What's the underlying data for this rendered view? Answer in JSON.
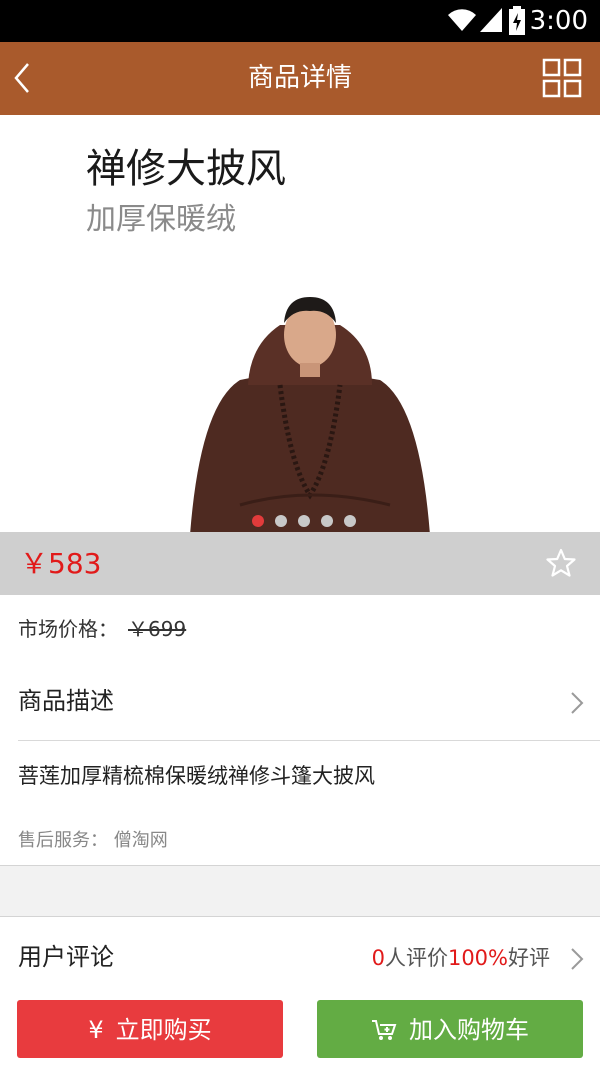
{
  "status_bar": {
    "time": "3:00",
    "icons": [
      "wifi-icon",
      "signal-icon",
      "battery-charging-icon"
    ]
  },
  "header": {
    "title": "商品详情",
    "back_icon": "back-arrow-icon",
    "menu_icon": "grid-menu-icon",
    "bg_color": "#a95a2c"
  },
  "hero": {
    "headline": "禅修大披风",
    "subline": "加厚保暖绒",
    "carousel_total": 5,
    "carousel_active": 1
  },
  "price": {
    "current": "￥583",
    "favorite_icon": "star-outline-icon",
    "color": "#e11a1a"
  },
  "market_price": {
    "label": "市场价格：",
    "value": "￥699"
  },
  "description": {
    "label": "商品描述",
    "text": "菩莲加厚精梳棉保暖绒禅修斗篷大披风"
  },
  "service": {
    "label": "售后服务：",
    "provider": "僧淘网"
  },
  "reviews": {
    "label": "用户评论",
    "count": "0",
    "count_suffix": "人评价",
    "rate": "100%",
    "rate_suffix": "好评"
  },
  "actions": {
    "buy": {
      "icon": "yen-icon",
      "label": "立即购买",
      "color": "#e83b3e"
    },
    "cart": {
      "icon": "add-cart-icon",
      "label": "加入购物车",
      "color": "#63ac44"
    }
  }
}
